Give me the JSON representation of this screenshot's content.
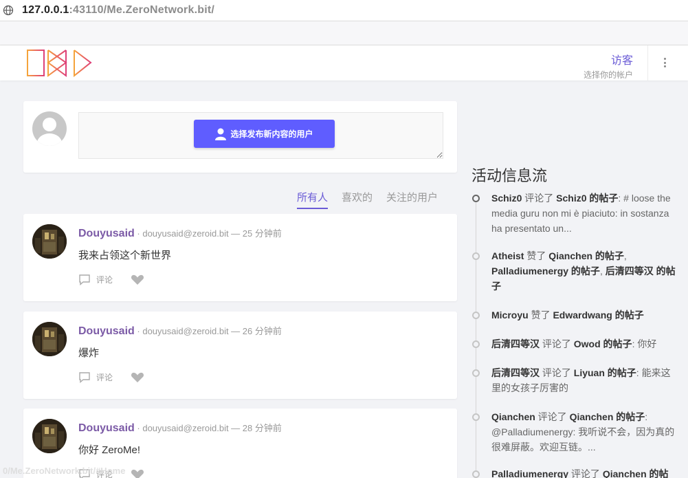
{
  "browser": {
    "url_host": "127.0.0.1",
    "url_rest": ":43110/Me.ZeroNetwork.bit/"
  },
  "header": {
    "user_name": "访客",
    "user_sub": "选择你的帐户"
  },
  "composer": {
    "button_label": "选择发布新内容的用户"
  },
  "tabs": [
    {
      "label": "所有人",
      "active": true
    },
    {
      "label": "喜欢的",
      "active": false
    },
    {
      "label": "关注的用户",
      "active": false
    }
  ],
  "posts": [
    {
      "author": "Douyusaid",
      "meta": " · douyusaid@zeroid.bit — 25 分钟前",
      "body": "我来占领这个新世界",
      "comment": "评论"
    },
    {
      "author": "Douyusaid",
      "meta": " · douyusaid@zeroid.bit — 26 分钟前",
      "body": "爆炸",
      "comment": "评论"
    },
    {
      "author": "Douyusaid",
      "meta": " · douyusaid@zeroid.bit — 28 分钟前",
      "body": "你好 ZeroMe!",
      "comment": "评论"
    }
  ],
  "feed": {
    "title": "活动信息流",
    "items": [
      {
        "segments": [
          {
            "b": true,
            "t": "Schiz0"
          },
          {
            "b": false,
            "t": " 评论了 "
          },
          {
            "b": true,
            "t": "Schiz0 的帖子"
          },
          {
            "b": false,
            "t": ": # loose the media guru non mi è piaciuto: in sostanza ha presentato un..."
          }
        ]
      },
      {
        "segments": [
          {
            "b": true,
            "t": "Atheist"
          },
          {
            "b": false,
            "t": " 赞了 "
          },
          {
            "b": true,
            "t": "Qianchen 的帖子"
          },
          {
            "b": false,
            "t": ", "
          },
          {
            "b": true,
            "t": "Palladiumenergy 的帖子"
          },
          {
            "b": false,
            "t": ", "
          },
          {
            "b": true,
            "t": "后清四等汉 的帖子"
          }
        ]
      },
      {
        "segments": [
          {
            "b": true,
            "t": "Microyu"
          },
          {
            "b": false,
            "t": " 赞了 "
          },
          {
            "b": true,
            "t": "Edwardwang 的帖子"
          }
        ]
      },
      {
        "segments": [
          {
            "b": true,
            "t": "后清四等汉"
          },
          {
            "b": false,
            "t": " 评论了 "
          },
          {
            "b": true,
            "t": "Owod 的帖子"
          },
          {
            "b": false,
            "t": ": 你好"
          }
        ]
      },
      {
        "segments": [
          {
            "b": true,
            "t": "后清四等汉"
          },
          {
            "b": false,
            "t": " 评论了 "
          },
          {
            "b": true,
            "t": "Liyuan 的帖子"
          },
          {
            "b": false,
            "t": ": 能来这里的女孩子厉害的"
          }
        ]
      },
      {
        "segments": [
          {
            "b": true,
            "t": "Qianchen"
          },
          {
            "b": false,
            "t": " 评论了 "
          },
          {
            "b": true,
            "t": "Qianchen 的帖子"
          },
          {
            "b": false,
            "t": ": @Palladiumenergy: 我听说不会，因为真的很难屏蔽。欢迎互链。..."
          }
        ]
      },
      {
        "segments": [
          {
            "b": true,
            "t": "Palladiumenergy"
          },
          {
            "b": false,
            "t": " 评论了 "
          },
          {
            "b": true,
            "t": "Qianchen 的帖"
          }
        ]
      }
    ]
  },
  "status_bar": "0/Me.ZeroNetwork.bit/#Home",
  "colors": {
    "accent": "#6a5bd6",
    "button": "#5f5dff",
    "author": "#7b5aa6"
  }
}
